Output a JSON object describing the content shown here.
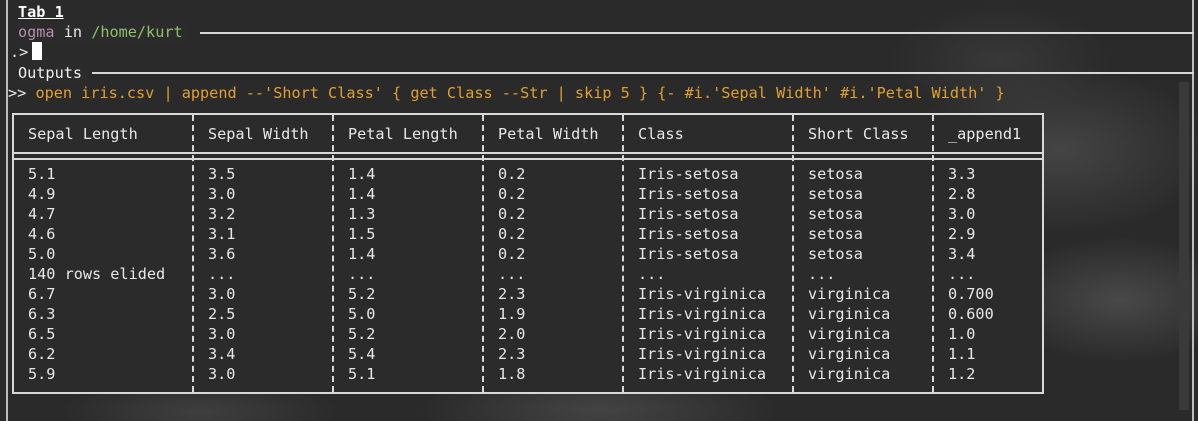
{
  "tab": {
    "title": "Tab 1"
  },
  "prompt": {
    "user": "ogma",
    "in": "in",
    "path": "/home/kurt",
    "input_prefix": ".>"
  },
  "outputs": {
    "label": "Outputs",
    "command_prefix": ">>",
    "command": "open iris.csv | append --'Short Class' { get Class --Str | skip 5 } {- #i.'Sepal Width' #i.'Petal Width' }"
  },
  "table": {
    "columns": [
      "Sepal Length",
      "Sepal Width",
      "Petal Length",
      "Petal Width",
      "Class",
      "Short Class",
      "_append1"
    ],
    "rows": [
      [
        "5.1",
        "3.5",
        "1.4",
        "0.2",
        "Iris-setosa",
        "setosa",
        "3.3"
      ],
      [
        "4.9",
        "3.0",
        "1.4",
        "0.2",
        "Iris-setosa",
        "setosa",
        "2.8"
      ],
      [
        "4.7",
        "3.2",
        "1.3",
        "0.2",
        "Iris-setosa",
        "setosa",
        "3.0"
      ],
      [
        "4.6",
        "3.1",
        "1.5",
        "0.2",
        "Iris-setosa",
        "setosa",
        "2.9"
      ],
      [
        "5.0",
        "3.6",
        "1.4",
        "0.2",
        "Iris-setosa",
        "setosa",
        "3.4"
      ],
      [
        "140 rows elided",
        "...",
        "...",
        "...",
        "...",
        "...",
        "..."
      ],
      [
        "6.7",
        "3.0",
        "5.2",
        "2.3",
        "Iris-virginica",
        "virginica",
        "0.700"
      ],
      [
        "6.3",
        "2.5",
        "5.0",
        "1.9",
        "Iris-virginica",
        "virginica",
        "0.600"
      ],
      [
        "6.5",
        "3.0",
        "5.2",
        "2.0",
        "Iris-virginica",
        "virginica",
        "1.0"
      ],
      [
        "6.2",
        "3.4",
        "5.4",
        "2.3",
        "Iris-virginica",
        "virginica",
        "1.1"
      ],
      [
        "5.9",
        "3.0",
        "5.1",
        "1.8",
        "Iris-virginica",
        "virginica",
        "1.2"
      ]
    ]
  },
  "colors": {
    "command": "#e0a030",
    "prompt_user": "#b48ead",
    "prompt_path": "#8fbf6a"
  }
}
